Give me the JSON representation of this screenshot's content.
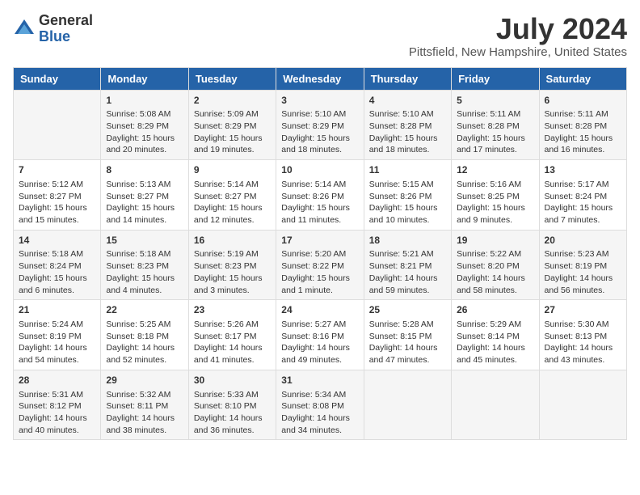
{
  "logo": {
    "general": "General",
    "blue": "Blue"
  },
  "title": "July 2024",
  "subtitle": "Pittsfield, New Hampshire, United States",
  "days_of_week": [
    "Sunday",
    "Monday",
    "Tuesday",
    "Wednesday",
    "Thursday",
    "Friday",
    "Saturday"
  ],
  "weeks": [
    [
      {
        "day": "",
        "info": ""
      },
      {
        "day": "1",
        "info": "Sunrise: 5:08 AM\nSunset: 8:29 PM\nDaylight: 15 hours\nand 20 minutes."
      },
      {
        "day": "2",
        "info": "Sunrise: 5:09 AM\nSunset: 8:29 PM\nDaylight: 15 hours\nand 19 minutes."
      },
      {
        "day": "3",
        "info": "Sunrise: 5:10 AM\nSunset: 8:29 PM\nDaylight: 15 hours\nand 18 minutes."
      },
      {
        "day": "4",
        "info": "Sunrise: 5:10 AM\nSunset: 8:28 PM\nDaylight: 15 hours\nand 18 minutes."
      },
      {
        "day": "5",
        "info": "Sunrise: 5:11 AM\nSunset: 8:28 PM\nDaylight: 15 hours\nand 17 minutes."
      },
      {
        "day": "6",
        "info": "Sunrise: 5:11 AM\nSunset: 8:28 PM\nDaylight: 15 hours\nand 16 minutes."
      }
    ],
    [
      {
        "day": "7",
        "info": "Sunrise: 5:12 AM\nSunset: 8:27 PM\nDaylight: 15 hours\nand 15 minutes."
      },
      {
        "day": "8",
        "info": "Sunrise: 5:13 AM\nSunset: 8:27 PM\nDaylight: 15 hours\nand 14 minutes."
      },
      {
        "day": "9",
        "info": "Sunrise: 5:14 AM\nSunset: 8:27 PM\nDaylight: 15 hours\nand 12 minutes."
      },
      {
        "day": "10",
        "info": "Sunrise: 5:14 AM\nSunset: 8:26 PM\nDaylight: 15 hours\nand 11 minutes."
      },
      {
        "day": "11",
        "info": "Sunrise: 5:15 AM\nSunset: 8:26 PM\nDaylight: 15 hours\nand 10 minutes."
      },
      {
        "day": "12",
        "info": "Sunrise: 5:16 AM\nSunset: 8:25 PM\nDaylight: 15 hours\nand 9 minutes."
      },
      {
        "day": "13",
        "info": "Sunrise: 5:17 AM\nSunset: 8:24 PM\nDaylight: 15 hours\nand 7 minutes."
      }
    ],
    [
      {
        "day": "14",
        "info": "Sunrise: 5:18 AM\nSunset: 8:24 PM\nDaylight: 15 hours\nand 6 minutes."
      },
      {
        "day": "15",
        "info": "Sunrise: 5:18 AM\nSunset: 8:23 PM\nDaylight: 15 hours\nand 4 minutes."
      },
      {
        "day": "16",
        "info": "Sunrise: 5:19 AM\nSunset: 8:23 PM\nDaylight: 15 hours\nand 3 minutes."
      },
      {
        "day": "17",
        "info": "Sunrise: 5:20 AM\nSunset: 8:22 PM\nDaylight: 15 hours\nand 1 minute."
      },
      {
        "day": "18",
        "info": "Sunrise: 5:21 AM\nSunset: 8:21 PM\nDaylight: 14 hours\nand 59 minutes."
      },
      {
        "day": "19",
        "info": "Sunrise: 5:22 AM\nSunset: 8:20 PM\nDaylight: 14 hours\nand 58 minutes."
      },
      {
        "day": "20",
        "info": "Sunrise: 5:23 AM\nSunset: 8:19 PM\nDaylight: 14 hours\nand 56 minutes."
      }
    ],
    [
      {
        "day": "21",
        "info": "Sunrise: 5:24 AM\nSunset: 8:19 PM\nDaylight: 14 hours\nand 54 minutes."
      },
      {
        "day": "22",
        "info": "Sunrise: 5:25 AM\nSunset: 8:18 PM\nDaylight: 14 hours\nand 52 minutes."
      },
      {
        "day": "23",
        "info": "Sunrise: 5:26 AM\nSunset: 8:17 PM\nDaylight: 14 hours\nand 41 minutes."
      },
      {
        "day": "24",
        "info": "Sunrise: 5:27 AM\nSunset: 8:16 PM\nDaylight: 14 hours\nand 49 minutes."
      },
      {
        "day": "25",
        "info": "Sunrise: 5:28 AM\nSunset: 8:15 PM\nDaylight: 14 hours\nand 47 minutes."
      },
      {
        "day": "26",
        "info": "Sunrise: 5:29 AM\nSunset: 8:14 PM\nDaylight: 14 hours\nand 45 minutes."
      },
      {
        "day": "27",
        "info": "Sunrise: 5:30 AM\nSunset: 8:13 PM\nDaylight: 14 hours\nand 43 minutes."
      }
    ],
    [
      {
        "day": "28",
        "info": "Sunrise: 5:31 AM\nSunset: 8:12 PM\nDaylight: 14 hours\nand 40 minutes."
      },
      {
        "day": "29",
        "info": "Sunrise: 5:32 AM\nSunset: 8:11 PM\nDaylight: 14 hours\nand 38 minutes."
      },
      {
        "day": "30",
        "info": "Sunrise: 5:33 AM\nSunset: 8:10 PM\nDaylight: 14 hours\nand 36 minutes."
      },
      {
        "day": "31",
        "info": "Sunrise: 5:34 AM\nSunset: 8:08 PM\nDaylight: 14 hours\nand 34 minutes."
      },
      {
        "day": "",
        "info": ""
      },
      {
        "day": "",
        "info": ""
      },
      {
        "day": "",
        "info": ""
      }
    ]
  ]
}
